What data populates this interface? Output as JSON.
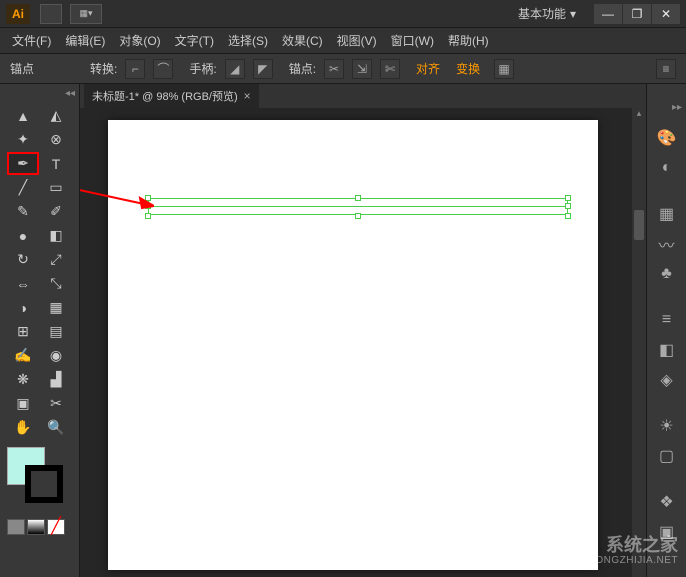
{
  "titlebar": {
    "logo": "Ai",
    "workspace": "基本功能",
    "win": {
      "min": "—",
      "max": "❐",
      "close": "✕"
    }
  },
  "menu": {
    "items": [
      "文件(F)",
      "编辑(E)",
      "对象(O)",
      "文字(T)",
      "选择(S)",
      "效果(C)",
      "视图(V)",
      "窗口(W)",
      "帮助(H)"
    ]
  },
  "ctrl": {
    "anchor_label": "锚点",
    "convert_label": "转换:",
    "handle_label": "手柄:",
    "anchors_label": "锚点:",
    "align_label": "对齐",
    "transform_label": "变换"
  },
  "doc": {
    "tab_title": "未标题-1* @ 98% (RGB/预览)",
    "tab_close": "×"
  },
  "tools": {
    "names": [
      "selection",
      "direct-selection",
      "magic-wand",
      "lasso",
      "pen",
      "type",
      "line",
      "rectangle",
      "brush",
      "pencil",
      "blob-brush",
      "eraser",
      "rotate",
      "scale",
      "width",
      "free-transform",
      "shape-builder",
      "perspective-grid",
      "mesh",
      "gradient",
      "eyedropper",
      "blend",
      "symbol-sprayer",
      "column-graph",
      "artboard",
      "slice",
      "hand",
      "zoom"
    ]
  },
  "right_panel": {
    "icons": [
      "color-icon",
      "color-guide-icon",
      "swatches-icon",
      "brushes-icon",
      "symbols-icon",
      "stroke-icon",
      "gradient-icon",
      "transparency-icon",
      "appearance-icon",
      "graphic-styles-icon",
      "layers-icon",
      "artboards-icon"
    ]
  },
  "watermark": {
    "line1": "系统之家",
    "line2": "XITONGZHIJIA.NET"
  },
  "colors": {
    "fill": "#b8f5e8",
    "stroke": "#000000",
    "selection": "#4ace4a",
    "accent": "#ff9a00",
    "highlight": "#ff0000"
  }
}
